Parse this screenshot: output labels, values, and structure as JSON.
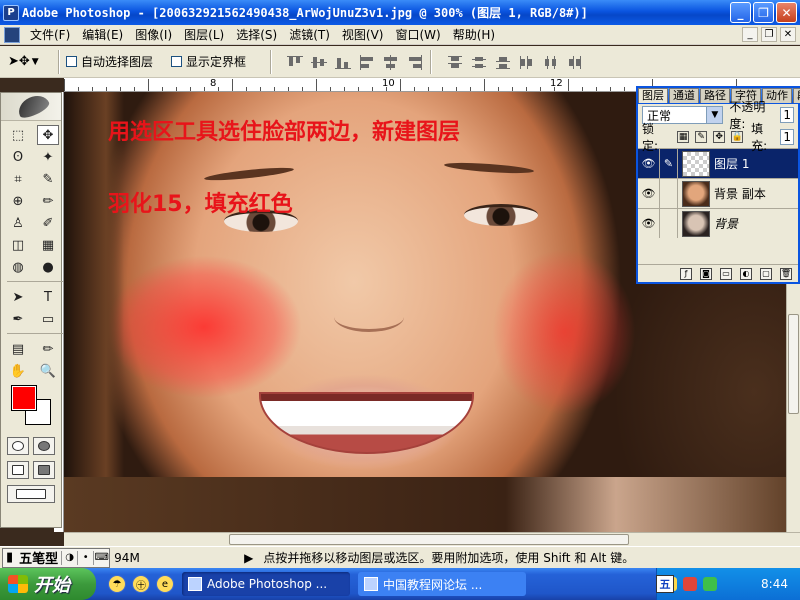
{
  "window": {
    "title": "Adobe Photoshop - [200632921562490438_ArWojUnuZ3v1.jpg @ 300% (图层 1, RGB/8#)]",
    "app_icon": "ps-icon",
    "buttons": {
      "minimize": "_",
      "maximize": "❐",
      "close": "✕"
    }
  },
  "menubar": {
    "items": [
      "文件(F)",
      "编辑(E)",
      "图像(I)",
      "图层(L)",
      "选择(S)",
      "滤镜(T)",
      "视图(V)",
      "窗口(W)",
      "帮助(H)"
    ],
    "right_controls": [
      "_",
      "❐",
      "✕"
    ]
  },
  "options": {
    "tool": "move-tool",
    "auto_select_layer": {
      "label": "自动选择图层",
      "checked": false
    },
    "show_bounding_box": {
      "label": "显示定界框",
      "checked": false
    }
  },
  "ruler": {
    "labels": [
      "8",
      "10",
      "12"
    ]
  },
  "canvas": {
    "lesson_line1": "用选区工具选住脸部两边，新建图层",
    "lesson_line2": "羽化15，填充红色"
  },
  "toolbox": {
    "tools": [
      "⬚",
      "✥",
      "ʘ",
      "✦",
      "⌗",
      "✎",
      "⊕",
      "✏",
      "♙",
      "✐",
      "◫",
      "▦",
      "◍",
      "●",
      "➤",
      "T",
      "✒",
      "▭",
      "▤",
      "✏",
      "✋",
      "🔍"
    ],
    "foreground_color": "#ff0000",
    "background_color": "#ffffff"
  },
  "layers_panel": {
    "tabs": [
      "图层",
      "通道",
      "路径",
      "字符",
      "动作",
      "段落"
    ],
    "blend_mode": "正常",
    "opacity_label": "不透明度:",
    "opacity_value": "1",
    "lock_label": "锁定:",
    "fill_label": "填充:",
    "fill_value": "1",
    "layers": [
      {
        "name": "图层 1",
        "visible": true,
        "selected": true
      },
      {
        "name": "背景 副本",
        "visible": true,
        "selected": false
      },
      {
        "name": "背景",
        "visible": true,
        "selected": false
      }
    ]
  },
  "statusbar": {
    "ime_label": "五笔型",
    "doc_size": "94M",
    "hint": "点按并拖移以移动图层或选区。要用附加选项，使用 Shift 和 Alt 键。"
  },
  "taskbar": {
    "start_label": "开始",
    "tasks": [
      {
        "label": "Adobe Photoshop ...",
        "active": true
      },
      {
        "label": "中国教程网论坛 ...",
        "active": false
      }
    ],
    "tray_ime": "五",
    "clock": "8:44"
  }
}
